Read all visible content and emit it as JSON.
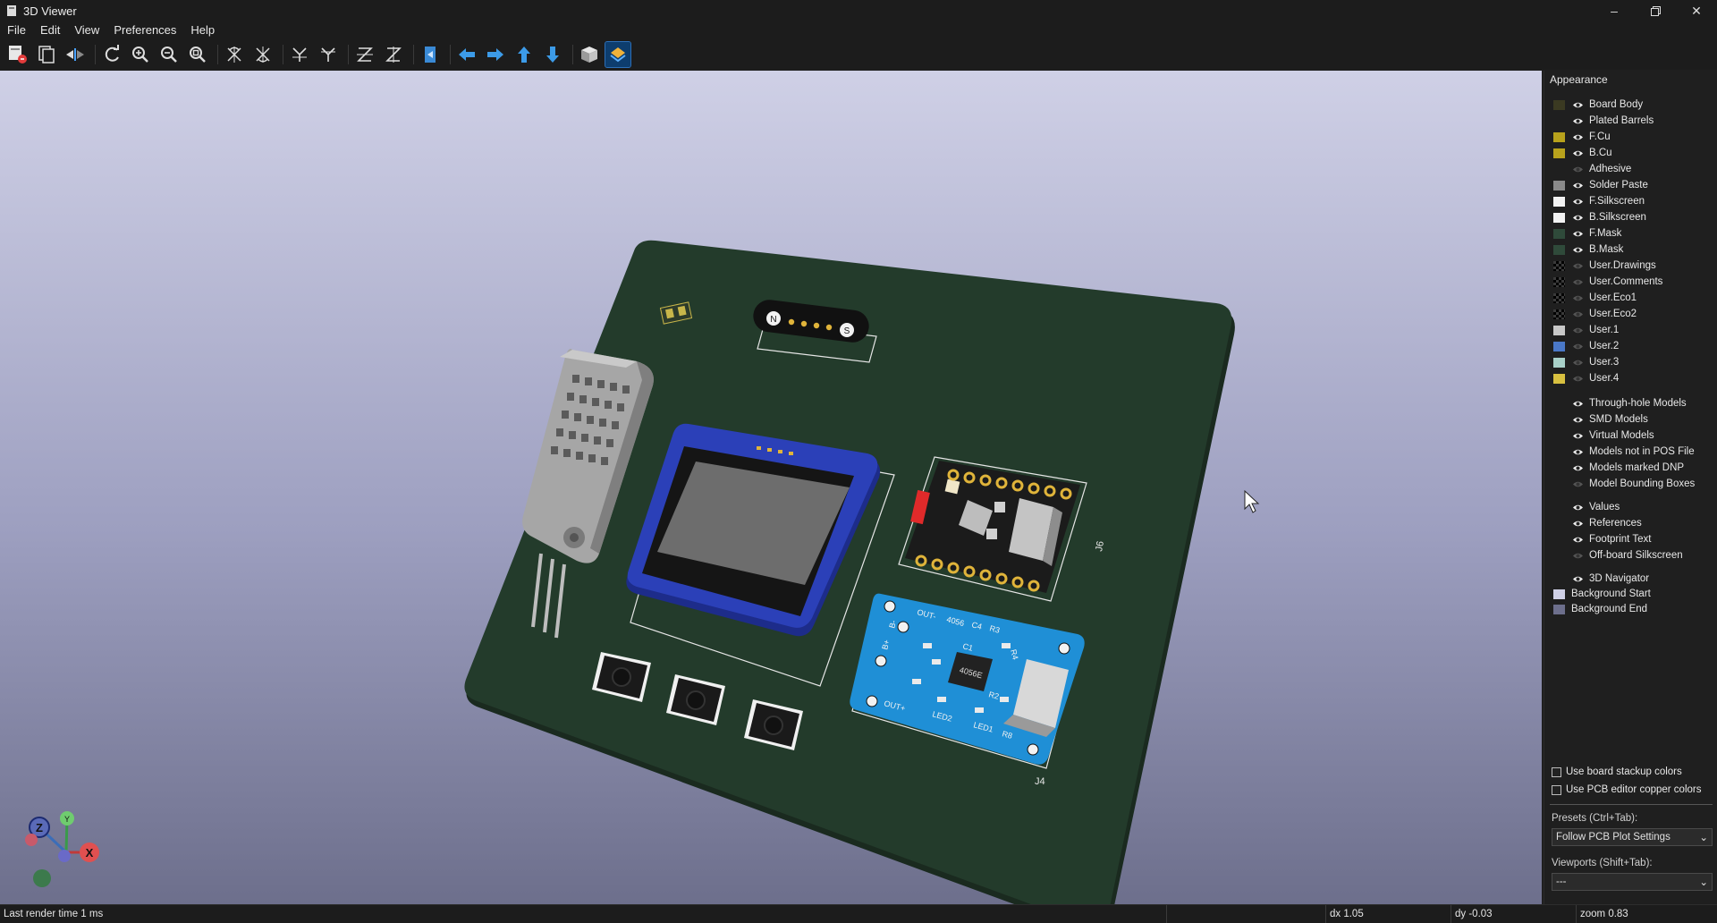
{
  "window": {
    "title": "3D Viewer",
    "controls": [
      "minimize-icon",
      "restore-icon",
      "close-icon"
    ]
  },
  "menu": [
    "File",
    "Edit",
    "View",
    "Preferences",
    "Help"
  ],
  "toolbar": {
    "icons": [
      "render-raytracing-icon",
      "copy-image-icon",
      "flip-board-icon",
      "reload-icon",
      "zoom-in-icon",
      "zoom-out-icon",
      "zoom-fit-icon",
      "rotate-x-cw-icon",
      "rotate-x-ccw-icon",
      "rotate-y-cw-icon",
      "rotate-y-ccw-icon",
      "rotate-z-cw-icon",
      "rotate-z-ccw-icon",
      "reset-view-icon",
      "move-left-icon",
      "move-right-icon",
      "move-up-icon",
      "move-down-icon",
      "orthographic-icon",
      "layers-manager-icon"
    ],
    "active": "layers-manager-icon"
  },
  "pcb": {
    "references": {
      "j6": "J6",
      "j4": "J4"
    },
    "module_text": {
      "header_left": "OUT-",
      "header_mid": "4056",
      "c4": "C4",
      "r3": "R3",
      "chip": "4056E",
      "bplus": "B+",
      "bminus": "B-",
      "outplus": "OUT+",
      "led2": "LED2",
      "led1": "LED1",
      "r8": "R8",
      "r2": "R2",
      "r4": "R4",
      "c1": "C1"
    },
    "pogo_labels": {
      "n": "N",
      "s": "S"
    }
  },
  "appearance": {
    "title": "Appearance",
    "layers": [
      {
        "label": "Board Body",
        "color": "#3b3a22",
        "visible": true
      },
      {
        "label": "Plated Barrels",
        "color": "",
        "visible": true
      },
      {
        "label": "F.Cu",
        "color": "#b8a21c",
        "visible": true
      },
      {
        "label": "B.Cu",
        "color": "#b8a21c",
        "visible": true
      },
      {
        "label": "Adhesive",
        "color": "",
        "visible": false
      },
      {
        "label": "Solder Paste",
        "color": "#8a8a8a",
        "visible": true
      },
      {
        "label": "F.Silkscreen",
        "color": "#f2f2f2",
        "visible": true
      },
      {
        "label": "B.Silkscreen",
        "color": "#f2f2f2",
        "visible": true
      },
      {
        "label": "F.Mask",
        "color": "#2f4a3a",
        "visible": true
      },
      {
        "label": "B.Mask",
        "color": "#2f4a3a",
        "visible": true
      },
      {
        "label": "User.Drawings",
        "color": "checker",
        "visible": false
      },
      {
        "label": "User.Comments",
        "color": "checker",
        "visible": false
      },
      {
        "label": "User.Eco1",
        "color": "checker",
        "visible": false
      },
      {
        "label": "User.Eco2",
        "color": "checker",
        "visible": false
      },
      {
        "label": "User.1",
        "color": "#c8c8c8",
        "visible": false
      },
      {
        "label": "User.2",
        "color": "#4a78c8",
        "visible": false
      },
      {
        "label": "User.3",
        "color": "#a8d0c8",
        "visible": false
      },
      {
        "label": "User.4",
        "color": "#d8c040",
        "visible": false
      }
    ],
    "models": [
      {
        "label": "Through-hole Models",
        "visible": true
      },
      {
        "label": "SMD Models",
        "visible": true
      },
      {
        "label": "Virtual Models",
        "visible": true
      },
      {
        "label": "Models not in POS File",
        "visible": true
      },
      {
        "label": "Models marked DNP",
        "visible": true
      },
      {
        "label": "Model Bounding Boxes",
        "visible": false
      }
    ],
    "text_items": [
      {
        "label": "Values",
        "visible": true
      },
      {
        "label": "References",
        "visible": true
      },
      {
        "label": "Footprint Text",
        "visible": true
      },
      {
        "label": "Off-board Silkscreen",
        "visible": false
      }
    ],
    "misc": [
      {
        "label": "3D Navigator",
        "color": "",
        "visible": true
      },
      {
        "label": "Background Start",
        "color": "#cfd0e6",
        "visible": null
      },
      {
        "label": "Background End",
        "color": "#6d6f8c",
        "visible": null
      }
    ],
    "checkboxes": [
      {
        "label": "Use board stackup colors",
        "checked": false
      },
      {
        "label": "Use PCB editor copper colors",
        "checked": false
      }
    ],
    "presets_label": "Presets (Ctrl+Tab):",
    "presets_value": "Follow PCB Plot Settings",
    "viewports_label": "Viewports (Shift+Tab):",
    "viewports_value": "---"
  },
  "navigator": {
    "z": "Z",
    "y": "Y",
    "x": "X"
  },
  "status": {
    "render_time": "Last render time 1 ms",
    "dx": "dx 1.05",
    "dy": "dy -0.03",
    "zoom": "zoom 0.83"
  },
  "colors": {
    "accent": "#2c6fb8",
    "board": "#233b2b",
    "module": "#1f8fd6",
    "oled": "#2b40b8"
  }
}
